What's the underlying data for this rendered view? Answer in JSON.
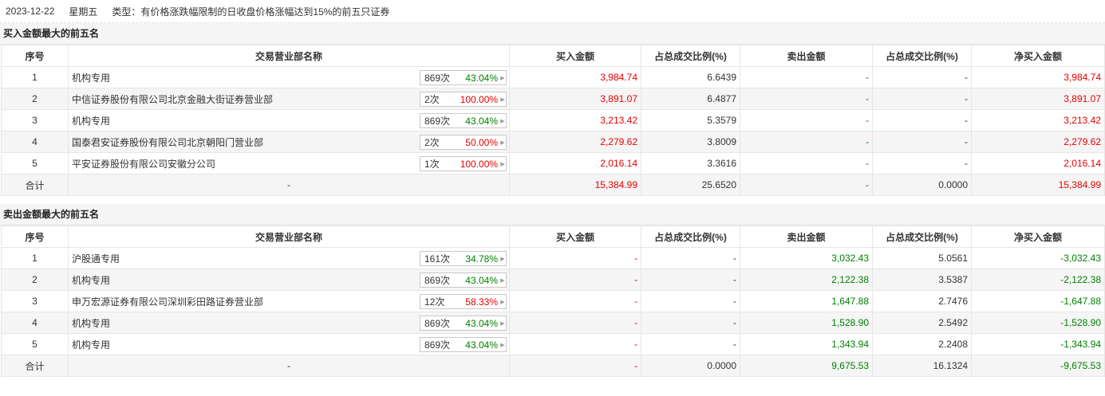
{
  "header": {
    "date": "2023-12-22",
    "weekday": "星期五",
    "type_label": "类型：有价格涨跌幅限制的日收盘价格涨幅达到15%的前五只证券"
  },
  "columns": [
    "序号",
    "交易营业部名称",
    "买入金额",
    "占总成交比例(%)",
    "卖出金额",
    "占总成交比例(%)",
    "净买入金额"
  ],
  "buy_section": {
    "title": "买入金额最大的前五名",
    "rows": [
      {
        "idx": "1",
        "name": "机构专用",
        "count": "869次",
        "rate": "43.04%",
        "rate_color": "green",
        "buy": "3,984.74",
        "buy_pct": "6.6439",
        "sell": "-",
        "sell_pct": "-",
        "net": "3,984.74"
      },
      {
        "idx": "2",
        "name": "中信证券股份有限公司北京金融大街证券营业部",
        "count": "2次",
        "rate": "100.00%",
        "rate_color": "red",
        "buy": "3,891.07",
        "buy_pct": "6.4877",
        "sell": "-",
        "sell_pct": "-",
        "net": "3,891.07"
      },
      {
        "idx": "3",
        "name": "机构专用",
        "count": "869次",
        "rate": "43.04%",
        "rate_color": "green",
        "buy": "3,213.42",
        "buy_pct": "5.3579",
        "sell": "-",
        "sell_pct": "-",
        "net": "3,213.42"
      },
      {
        "idx": "4",
        "name": "国泰君安证券股份有限公司北京朝阳门营业部",
        "count": "2次",
        "rate": "50.00%",
        "rate_color": "red",
        "buy": "2,279.62",
        "buy_pct": "3.8009",
        "sell": "-",
        "sell_pct": "-",
        "net": "2,279.62"
      },
      {
        "idx": "5",
        "name": "平安证券股份有限公司安徽分公司",
        "count": "1次",
        "rate": "100.00%",
        "rate_color": "red",
        "buy": "2,016.14",
        "buy_pct": "3.3616",
        "sell": "-",
        "sell_pct": "-",
        "net": "2,016.14"
      }
    ],
    "total": {
      "label": "合计",
      "name": "-",
      "buy": "15,384.99",
      "buy_pct": "25.6520",
      "sell": "-",
      "sell_pct": "0.0000",
      "net": "15,384.99"
    }
  },
  "sell_section": {
    "title": "卖出金额最大的前五名",
    "rows": [
      {
        "idx": "1",
        "name": "沪股通专用",
        "count": "161次",
        "rate": "34.78%",
        "rate_color": "green",
        "buy": "-",
        "buy_pct": "-",
        "sell": "3,032.43",
        "sell_pct": "5.0561",
        "net": "-3,032.43"
      },
      {
        "idx": "2",
        "name": "机构专用",
        "count": "869次",
        "rate": "43.04%",
        "rate_color": "green",
        "buy": "-",
        "buy_pct": "-",
        "sell": "2,122.38",
        "sell_pct": "3.5387",
        "net": "-2,122.38"
      },
      {
        "idx": "3",
        "name": "申万宏源证券有限公司深圳彩田路证券营业部",
        "count": "12次",
        "rate": "58.33%",
        "rate_color": "red",
        "buy": "-",
        "buy_pct": "-",
        "sell": "1,647.88",
        "sell_pct": "2.7476",
        "net": "-1,647.88"
      },
      {
        "idx": "4",
        "name": "机构专用",
        "count": "869次",
        "rate": "43.04%",
        "rate_color": "green",
        "buy": "-",
        "buy_pct": "-",
        "sell": "1,528.90",
        "sell_pct": "2.5492",
        "net": "-1,528.90"
      },
      {
        "idx": "5",
        "name": "机构专用",
        "count": "869次",
        "rate": "43.04%",
        "rate_color": "green",
        "buy": "-",
        "buy_pct": "-",
        "sell": "1,343.94",
        "sell_pct": "2.2408",
        "net": "-1,343.94"
      }
    ],
    "total": {
      "label": "合计",
      "name": "-",
      "buy": "-",
      "buy_pct": "0.0000",
      "sell": "9,675.53",
      "sell_pct": "16.1324",
      "net": "-9,675.53"
    }
  },
  "colors": {
    "up": "#e60000",
    "down": "#008000"
  }
}
